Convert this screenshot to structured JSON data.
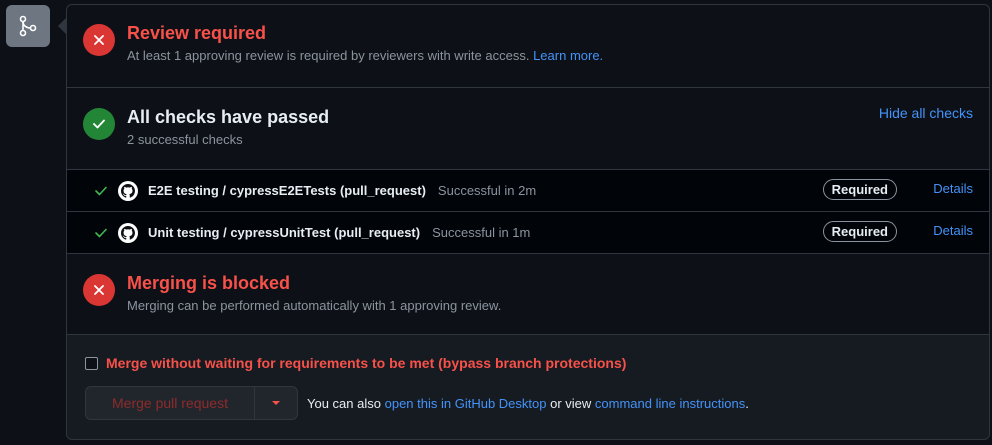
{
  "review": {
    "title": "Review required",
    "desc": "At least 1 approving review is required by reviewers with write access.",
    "learn_more": "Learn more."
  },
  "checks": {
    "title": "All checks have passed",
    "desc": "2 successful checks",
    "hide_all": "Hide all checks",
    "items": [
      {
        "name": "E2E testing / cypressE2ETests (pull_request)",
        "status": "Successful in 2m",
        "badge": "Required",
        "details": "Details"
      },
      {
        "name": "Unit testing / cypressUnitTest (pull_request)",
        "status": "Successful in 1m",
        "badge": "Required",
        "details": "Details"
      }
    ]
  },
  "merging": {
    "title": "Merging is blocked",
    "desc": "Merging can be performed automatically with 1 approving review."
  },
  "bypass": {
    "label": "Merge without waiting for requirements to be met (bypass branch protections)",
    "checked": false
  },
  "merge": {
    "button": "Merge pull request",
    "alt_prefix": "You can also",
    "desktop_link": "open this in GitHub Desktop",
    "alt_middle": "or view",
    "cli_link": "command line instructions",
    "alt_suffix": "."
  },
  "colors": {
    "danger": "#f85149",
    "success": "#238636",
    "link": "#4493f8"
  },
  "icons": {
    "merge": "git-merge-icon",
    "x": "x-circle-icon",
    "check": "check-circle-icon",
    "tick": "check-icon",
    "github": "github-icon",
    "caret": "triangle-down-icon"
  }
}
